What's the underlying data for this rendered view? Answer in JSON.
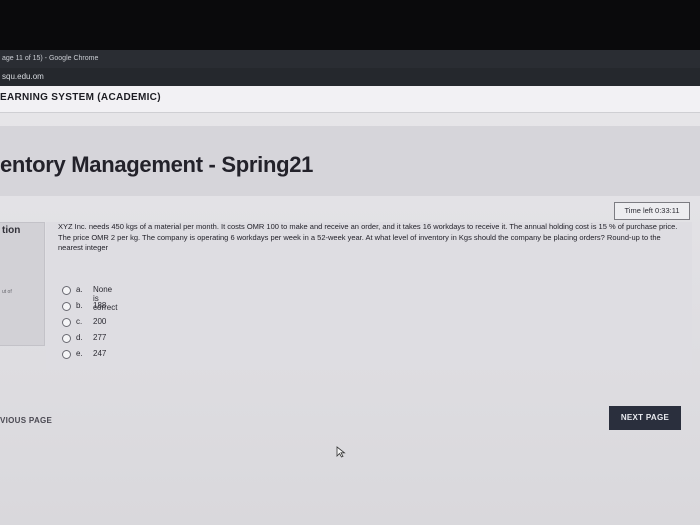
{
  "browser": {
    "window_title": "age 11 of 15) - Google Chrome",
    "url_domain": "squ.edu.om"
  },
  "site": {
    "system_name": "EARNING SYSTEM (ACADEMIC)"
  },
  "course": {
    "title": "entory Management - Spring21"
  },
  "quiz": {
    "timer": "Time left 0:33:11",
    "side_label": "tion",
    "side_marks": "ut of",
    "question": "XYZ Inc. needs 450 kgs of a material per month. It costs OMR 100 to make and receive an order, and it takes 16 workdays to receive it. The annual holding cost is 15 % of purchase price. The price OMR 2 per kg. The company is operating 6 workdays per week in a 52-week year. At what level of inventory in Kgs should the company be placing orders? Round-up to the nearest integer",
    "options": [
      {
        "key": "a.",
        "value": "None is correct"
      },
      {
        "key": "b.",
        "value": "188"
      },
      {
        "key": "c.",
        "value": "200"
      },
      {
        "key": "d.",
        "value": "277"
      },
      {
        "key": "e.",
        "value": "247"
      }
    ]
  },
  "nav": {
    "previous_label": "VIOUS PAGE",
    "next_label": "NEXT PAGE"
  },
  "icons": {
    "cursor": "mouse-pointer-icon",
    "radio": "radio-button-icon"
  }
}
